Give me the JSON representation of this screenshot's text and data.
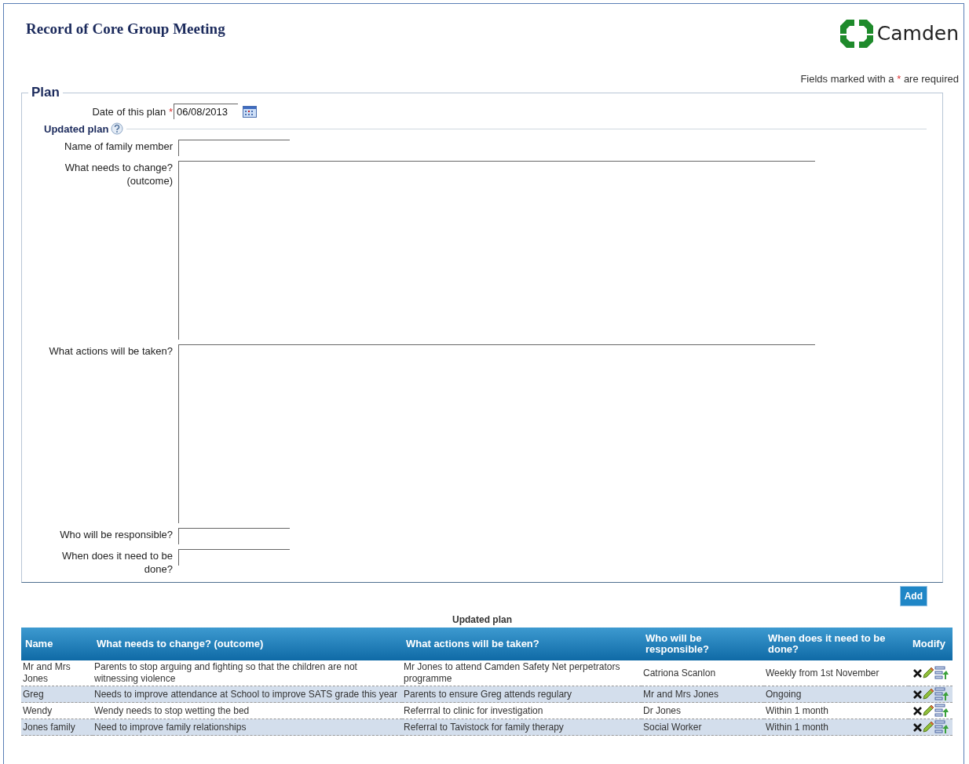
{
  "page": {
    "title": "Record of Core Group Meeting",
    "logo_text": "Camden",
    "required_note": {
      "before": "Fields marked with a",
      "mark": "*",
      "after": "are required"
    }
  },
  "plan": {
    "legend": "Plan",
    "date": {
      "label": "Date of this plan",
      "required_mark": "*",
      "value": "06/08/2013"
    },
    "section": "Updated plan",
    "fields": [
      {
        "kind": "input",
        "label": "Name of family member"
      },
      {
        "kind": "textarea",
        "label": "What needs to change? (outcome)"
      },
      {
        "kind": "textarea",
        "label": "What actions will be taken?"
      },
      {
        "kind": "input",
        "label": "Who will be responsible?"
      },
      {
        "kind": "input",
        "label": "When does it need to be done?"
      }
    ]
  },
  "add_button": "Add",
  "table": {
    "caption": "Updated plan",
    "columns": [
      "Name",
      "What needs to change? (outcome)",
      "What actions will be taken?",
      "Who will be responsible?",
      "When does it need to be done?",
      "Modify"
    ],
    "rows": [
      {
        "cells": [
          "Mr and Mrs Jones",
          "Parents to stop arguing and fighting so that the children are not witnessing violence",
          "Mr Jones to attend Camden Safety Net perpetrators programme",
          "Catriona Scanlon",
          "Weekly from 1st November"
        ]
      },
      {
        "cells": [
          "Greg",
          "Needs to improve attendance at School to improve SATS grade this year",
          "Parents to ensure Greg attends regulary",
          "Mr and Mrs Jones",
          "Ongoing"
        ]
      },
      {
        "cells": [
          "Wendy",
          "Wendy needs to stop wetting the bed",
          "Referrral to clinic for investigation",
          "Dr Jones",
          "Within 1 month"
        ]
      },
      {
        "cells": [
          "Jones family",
          "Need to improve family relationships",
          "Referral to Tavistock for family therapy",
          "Social Worker",
          "Within 1 month"
        ]
      }
    ]
  }
}
